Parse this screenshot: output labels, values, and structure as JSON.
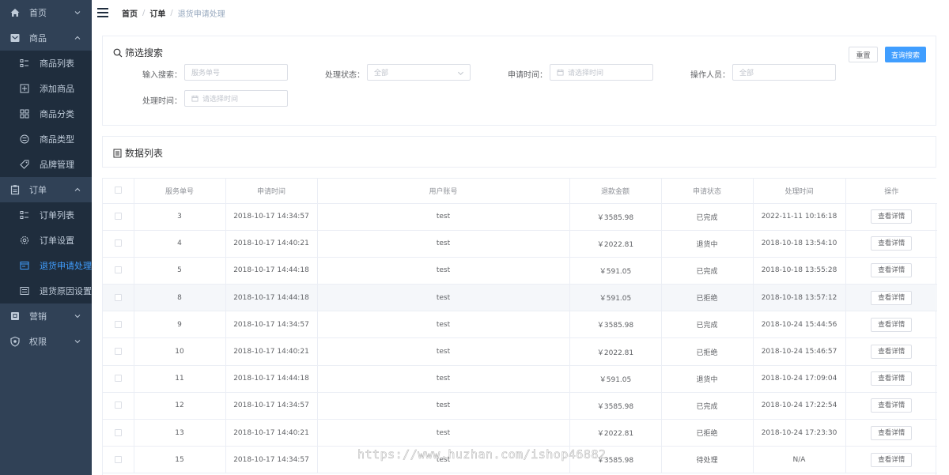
{
  "sidebar": {
    "items": [
      {
        "label": "首页",
        "type": "top",
        "icon": "home-icon"
      },
      {
        "label": "商品",
        "type": "top",
        "icon": "goods-icon"
      },
      {
        "label": "商品列表",
        "type": "sub",
        "icon": "list-icon"
      },
      {
        "label": "添加商品",
        "type": "sub",
        "icon": "add-icon"
      },
      {
        "label": "商品分类",
        "type": "sub",
        "icon": "category-icon"
      },
      {
        "label": "商品类型",
        "type": "sub",
        "icon": "type-icon"
      },
      {
        "label": "品牌管理",
        "type": "sub",
        "icon": "tag-icon"
      },
      {
        "label": "订单",
        "type": "top",
        "icon": "order-icon"
      },
      {
        "label": "订单列表",
        "type": "sub",
        "icon": "list-icon"
      },
      {
        "label": "订单设置",
        "type": "sub",
        "icon": "settings-icon"
      },
      {
        "label": "退货申请处理",
        "type": "sub",
        "icon": "return-icon",
        "active": true
      },
      {
        "label": "退货原因设置",
        "type": "sub",
        "icon": "reason-icon"
      },
      {
        "label": "营销",
        "type": "top",
        "icon": "marketing-icon"
      },
      {
        "label": "权限",
        "type": "top",
        "icon": "shield-icon"
      }
    ],
    "background": "#304156",
    "active_color": "#409eff"
  },
  "header": {
    "breadcrumb": [
      "首页",
      "订单",
      "退货申请处理"
    ]
  },
  "filter": {
    "title": "筛选搜索",
    "reset_label": "重置",
    "query_label": "查询搜索",
    "fields": {
      "keyword_label": "输入搜索：",
      "keyword_placeholder": "服务单号",
      "status_label": "处理状态：",
      "status_value": "全部",
      "apply_time_label": "申请时间：",
      "apply_time_placeholder": "请选择时间",
      "operator_label": "操作人员：",
      "operator_placeholder": "全部",
      "handle_time_label": "处理时间：",
      "handle_time_placeholder": "请选择时间"
    }
  },
  "list": {
    "title": "数据列表"
  },
  "table": {
    "columns": [
      "服务单号",
      "申请时间",
      "用户账号",
      "退款金额",
      "申请状态",
      "处理时间",
      "操作"
    ],
    "action_label": "查看详情",
    "rows": [
      {
        "id": "3",
        "apply_time": "2018-10-17 14:34:57",
        "user": "test",
        "amount": "￥3585.98",
        "status": "已完成",
        "handle_time": "2022-11-11 10:16:18"
      },
      {
        "id": "4",
        "apply_time": "2018-10-17 14:40:21",
        "user": "test",
        "amount": "￥2022.81",
        "status": "退货中",
        "handle_time": "2018-10-18 13:54:10"
      },
      {
        "id": "5",
        "apply_time": "2018-10-17 14:44:18",
        "user": "test",
        "amount": "￥591.05",
        "status": "已完成",
        "handle_time": "2018-10-18 13:55:28"
      },
      {
        "id": "8",
        "apply_time": "2018-10-17 14:44:18",
        "user": "test",
        "amount": "￥591.05",
        "status": "已拒绝",
        "handle_time": "2018-10-18 13:57:12",
        "highlight": true
      },
      {
        "id": "9",
        "apply_time": "2018-10-17 14:34:57",
        "user": "test",
        "amount": "￥3585.98",
        "status": "已完成",
        "handle_time": "2018-10-24 15:44:56"
      },
      {
        "id": "10",
        "apply_time": "2018-10-17 14:40:21",
        "user": "test",
        "amount": "￥2022.81",
        "status": "已拒绝",
        "handle_time": "2018-10-24 15:46:57"
      },
      {
        "id": "11",
        "apply_time": "2018-10-17 14:44:18",
        "user": "test",
        "amount": "￥591.05",
        "status": "退货中",
        "handle_time": "2018-10-24 17:09:04"
      },
      {
        "id": "12",
        "apply_time": "2018-10-17 14:34:57",
        "user": "test",
        "amount": "￥3585.98",
        "status": "已完成",
        "handle_time": "2018-10-24 17:22:54"
      },
      {
        "id": "13",
        "apply_time": "2018-10-17 14:40:21",
        "user": "test",
        "amount": "￥2022.81",
        "status": "已拒绝",
        "handle_time": "2018-10-24 17:23:30"
      },
      {
        "id": "15",
        "apply_time": "2018-10-17 14:34:57",
        "user": "test",
        "amount": "￥3585.98",
        "status": "待处理",
        "handle_time": "N/A"
      }
    ]
  },
  "watermark": "https://www.huzhan.com/ishop46882"
}
